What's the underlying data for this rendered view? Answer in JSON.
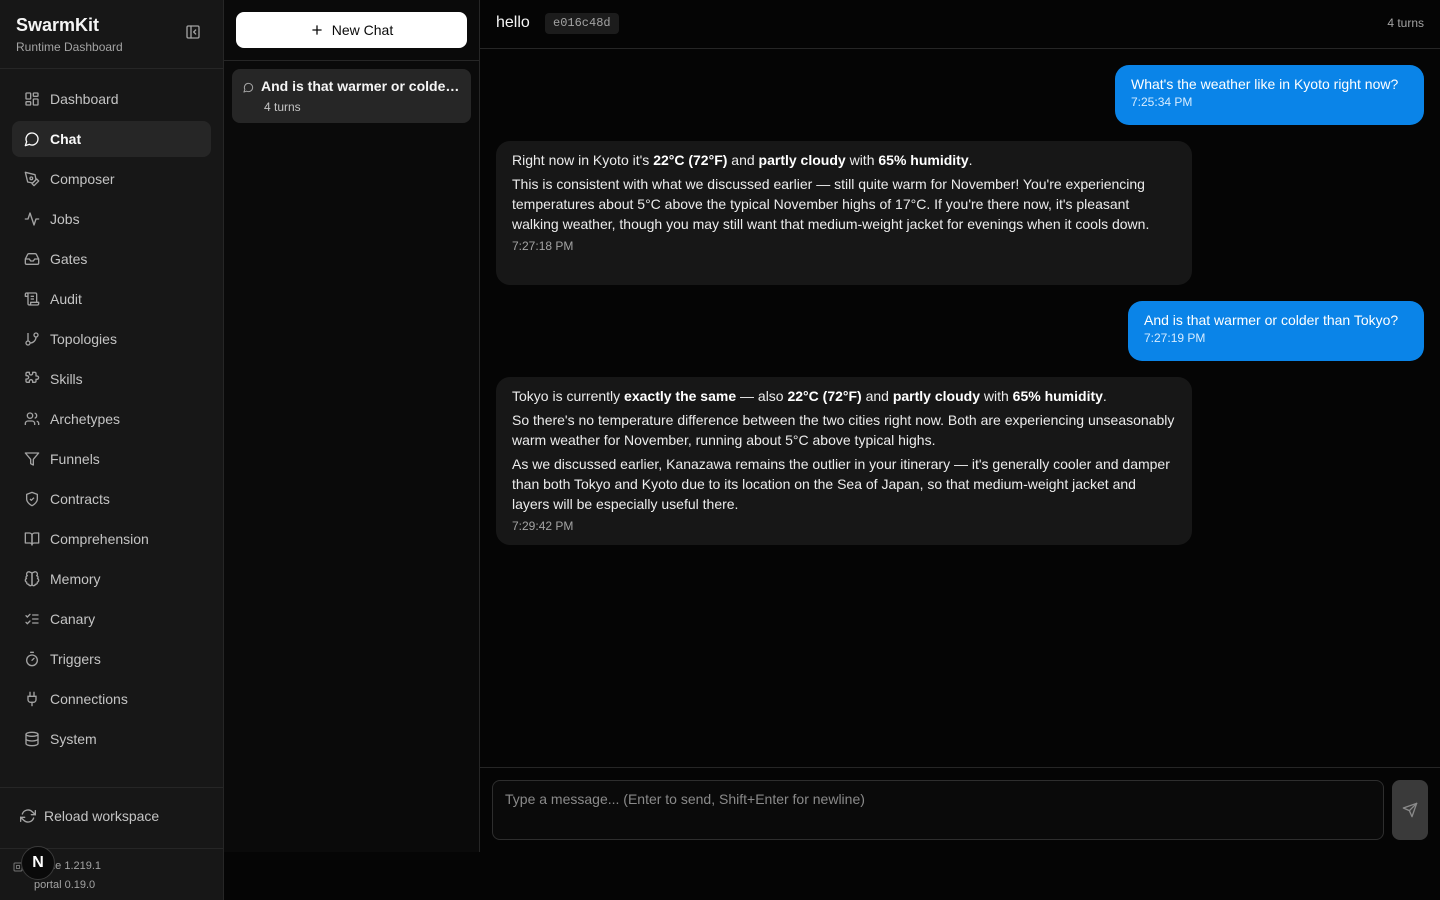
{
  "brand": {
    "title": "SwarmKit",
    "subtitle": "Runtime Dashboard"
  },
  "sidebar": {
    "items": [
      {
        "label": "Dashboard",
        "icon": "grid-icon"
      },
      {
        "label": "Chat",
        "icon": "message-circle-icon",
        "active": true
      },
      {
        "label": "Composer",
        "icon": "pen-tool-icon"
      },
      {
        "label": "Jobs",
        "icon": "activity-icon"
      },
      {
        "label": "Gates",
        "icon": "inbox-icon"
      },
      {
        "label": "Audit",
        "icon": "scroll-icon"
      },
      {
        "label": "Topologies",
        "icon": "git-branch-icon"
      },
      {
        "label": "Skills",
        "icon": "puzzle-icon"
      },
      {
        "label": "Archetypes",
        "icon": "users-icon"
      },
      {
        "label": "Funnels",
        "icon": "filter-icon"
      },
      {
        "label": "Contracts",
        "icon": "shield-check-icon"
      },
      {
        "label": "Comprehension",
        "icon": "book-open-icon"
      },
      {
        "label": "Memory",
        "icon": "brain-icon"
      },
      {
        "label": "Canary",
        "icon": "list-checks-icon"
      },
      {
        "label": "Triggers",
        "icon": "timer-icon"
      },
      {
        "label": "Connections",
        "icon": "plug-icon"
      },
      {
        "label": "System",
        "icon": "database-icon"
      }
    ],
    "reload_label": "Reload workspace",
    "runtime_version": "me 1.219.1",
    "portal_version": "portal 0.19.0",
    "avatar_letter": "N"
  },
  "chatlist": {
    "new_chat_label": "New Chat",
    "conversations": [
      {
        "title": "And is that warmer or colder than Tokyo?",
        "turns": "4 turns"
      }
    ]
  },
  "header": {
    "title": "hello",
    "id": "e016c48d",
    "turns": "4 turns"
  },
  "messages": [
    {
      "role": "user",
      "text": "What's the weather like in Kyoto right now?",
      "time": "7:25:34 PM"
    },
    {
      "role": "assistant",
      "p1_a": "Right now in Kyoto it's ",
      "p1_b1": "22°C (72°F)",
      "p1_c": " and ",
      "p1_b2": "partly cloudy",
      "p1_d": " with ",
      "p1_b3": "65% humidity",
      "p1_e": ".",
      "p2": "This is consistent with what we discussed earlier — still quite warm for November! You're experiencing temperatures about 5°C above the typical November highs of 17°C. If you're there now, it's pleasant walking weather, though you may still want that medium-weight jacket for evenings when it cools down.",
      "time": "7:27:18 PM"
    },
    {
      "role": "user",
      "text": "And is that warmer or colder than Tokyo?",
      "time": "7:27:19 PM"
    },
    {
      "role": "assistant",
      "p1_a": "Tokyo is currently ",
      "p1_b0": "exactly the same",
      "p1_a2": " — also ",
      "p1_b1": "22°C (72°F)",
      "p1_c": " and ",
      "p1_b2": "partly cloudy",
      "p1_d": " with ",
      "p1_b3": "65% humidity",
      "p1_e": ".",
      "p2": "So there's no temperature difference between the two cities right now. Both are experiencing unseasonably warm weather for November, running about 5°C above typical highs.",
      "p3": "As we discussed earlier, Kanazawa remains the outlier in your itinerary — it's generally cooler and damper than both Tokyo and Kyoto due to its location on the Sea of Japan, so that medium-weight jacket and layers will be especially useful there.",
      "time": "7:29:42 PM"
    }
  ],
  "composer": {
    "placeholder": "Type a message... (Enter to send, Shift+Enter for newline)",
    "value": ""
  },
  "colors": {
    "user_bubble": "#0a84e8",
    "assistant_bubble": "#171717",
    "sidebar_bg": "#171717",
    "active_item": "#262626"
  }
}
